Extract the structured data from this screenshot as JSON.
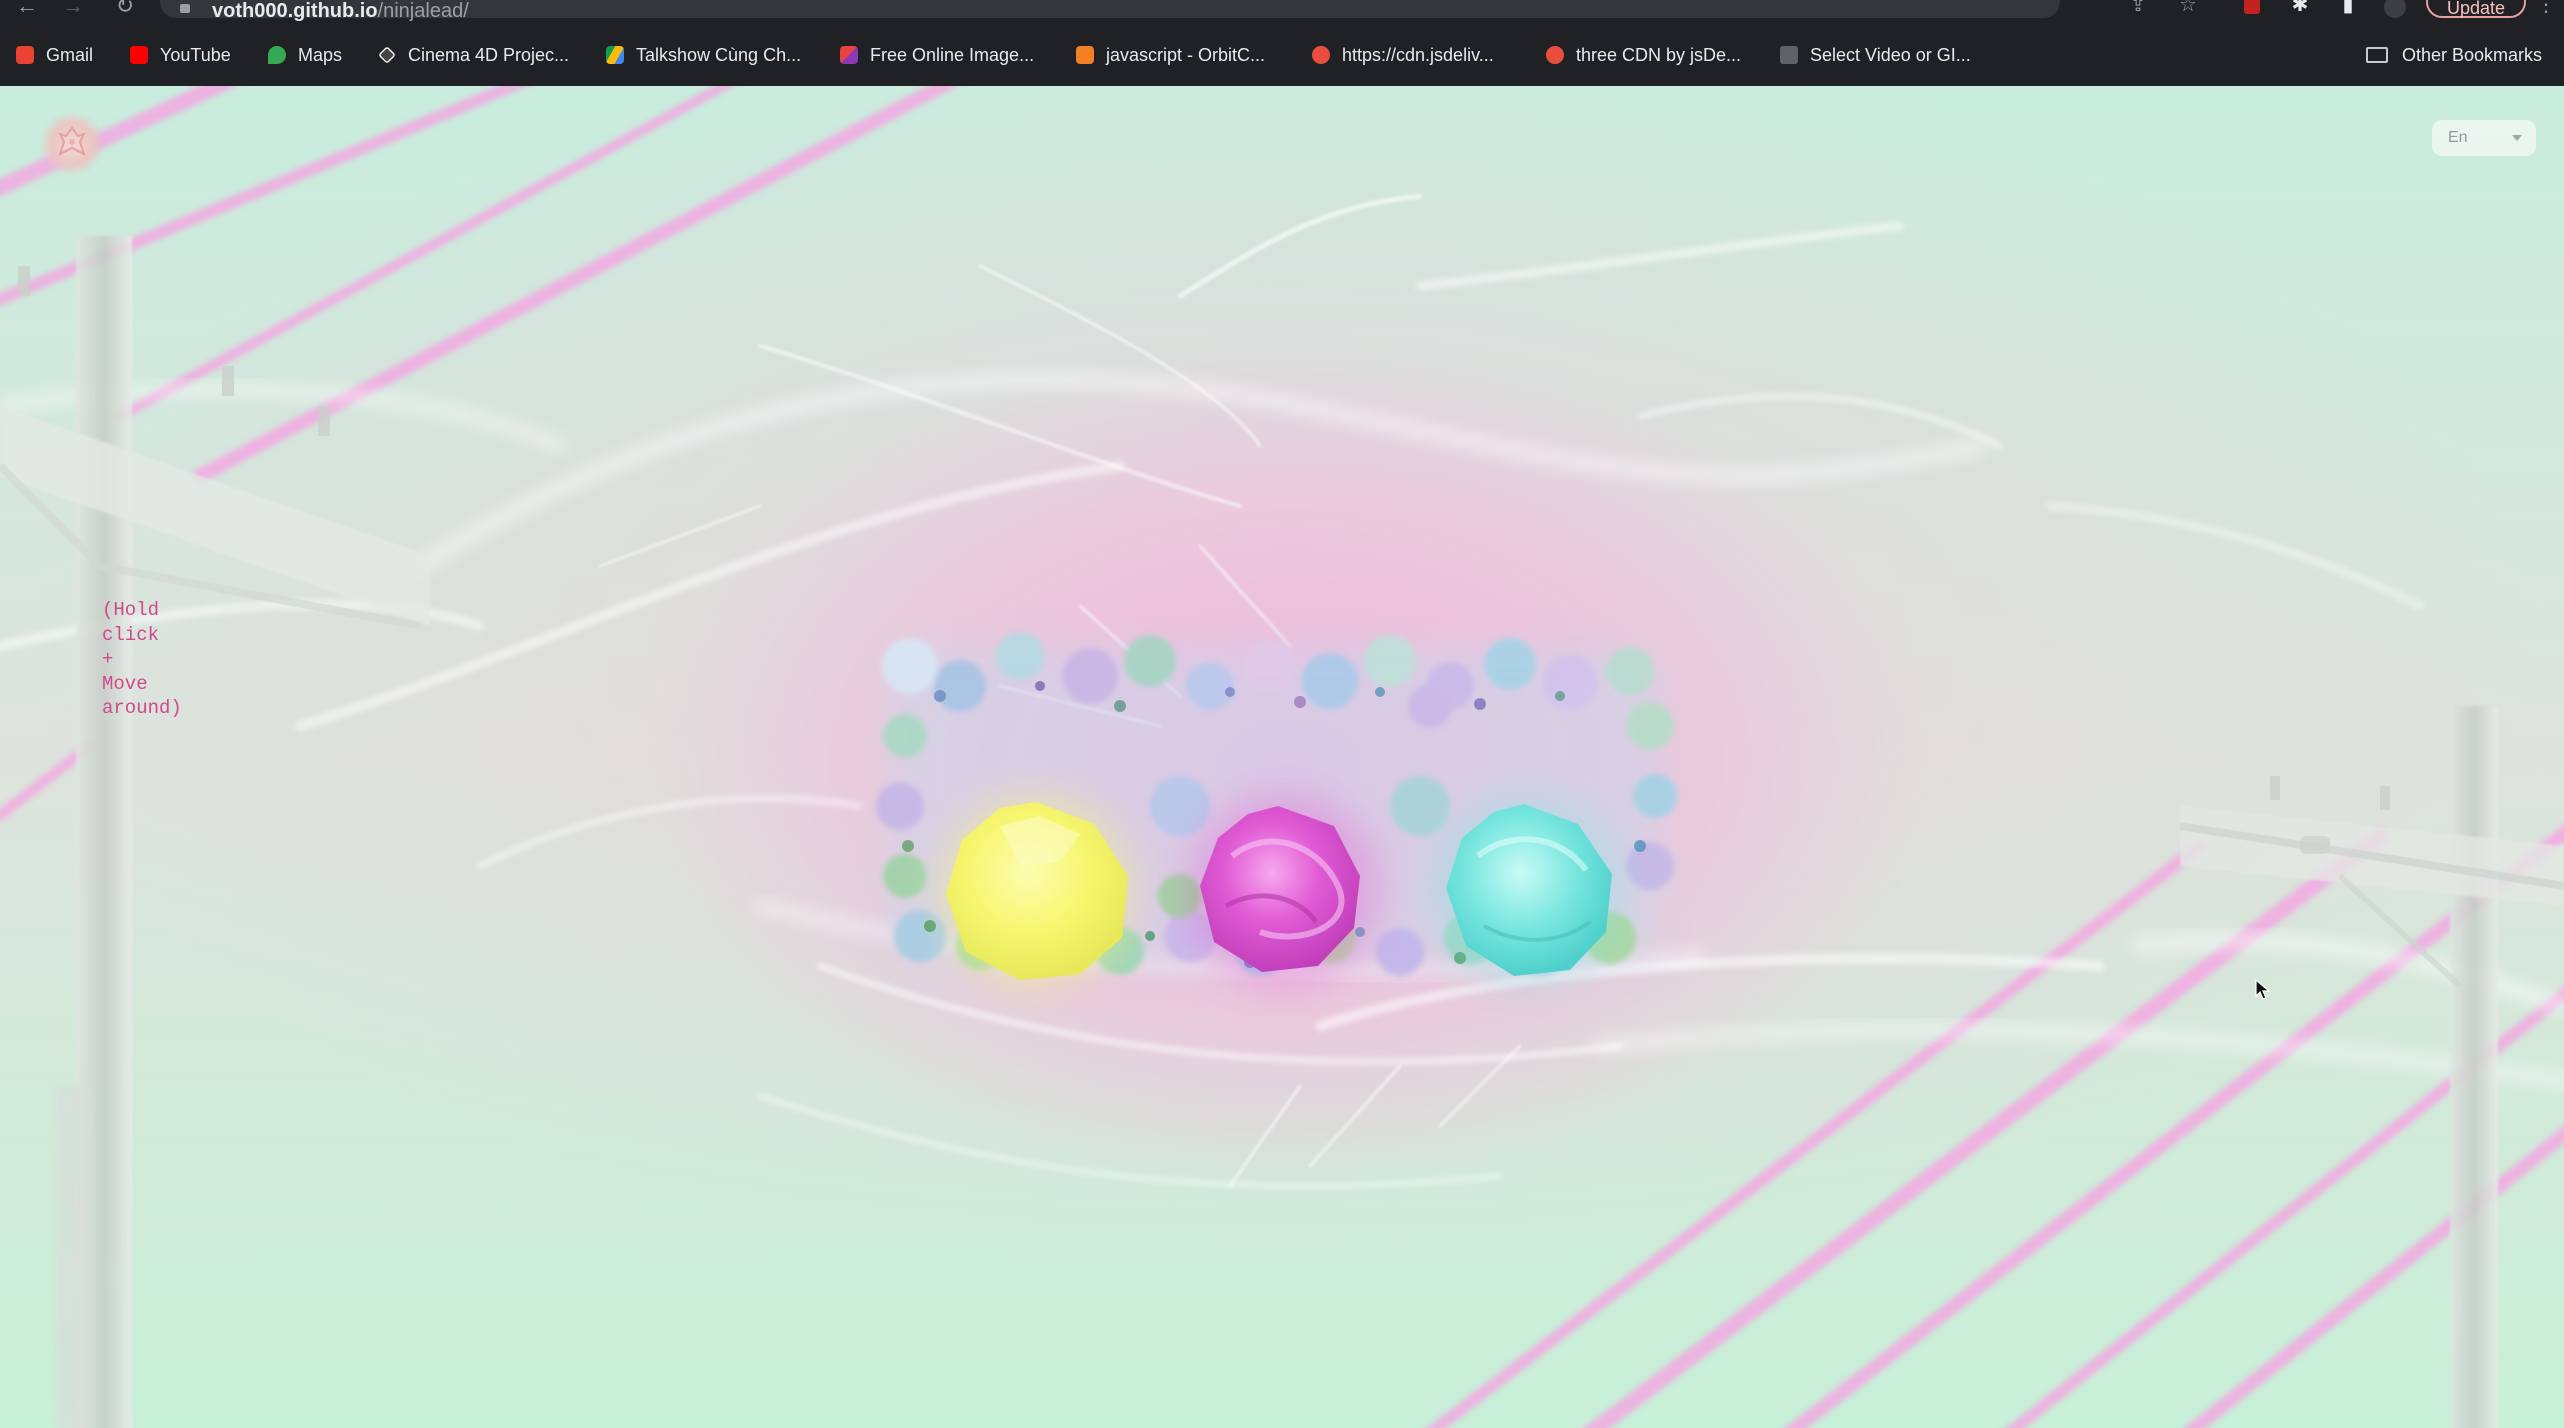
{
  "browser": {
    "url_host": "voth000.github.io",
    "url_path": "/ninjalead/",
    "update_label": "Update"
  },
  "bookmarks": [
    {
      "label": "Gmail",
      "icon": "gmail-icon",
      "color": "#ea4335"
    },
    {
      "label": "YouTube",
      "icon": "youtube-icon",
      "color": "#ff0000"
    },
    {
      "label": "Maps",
      "icon": "maps-icon",
      "color": "#34a853"
    },
    {
      "label": "Cinema 4D Projec...",
      "icon": "cinema4d-icon",
      "color": "#ffffff"
    },
    {
      "label": "Talkshow Cùng Ch...",
      "icon": "drive-icon",
      "color": "#fbbc04"
    },
    {
      "label": "Free Online Image...",
      "icon": "image-tool-icon",
      "color": "#e8433e"
    },
    {
      "label": "javascript - OrbitC...",
      "icon": "stackoverflow-icon",
      "color": "#f48024"
    },
    {
      "label": "https://cdn.jsdeliv...",
      "icon": "jsdelivr-icon",
      "color": "#e84d3d"
    },
    {
      "label": "three CDN by jsDe...",
      "icon": "jsdelivr-icon",
      "color": "#e84d3d"
    },
    {
      "label": "Select Video or GI...",
      "icon": "video-icon",
      "color": "#9aa0a6"
    }
  ],
  "other_bookmarks_label": "Other Bookmarks",
  "page": {
    "language_selected": "En",
    "hint_text": "(Hold\nclick\n+\nMove\naround)",
    "colors": {
      "yellow_orb": "#f9f77c",
      "magenta_orb": "#e25bd4",
      "cyan_orb": "#7fe9e0",
      "pink_glow": "#f0b6dc",
      "mint_bg": "#c8eddd",
      "hint_text": "#d0498a"
    }
  }
}
